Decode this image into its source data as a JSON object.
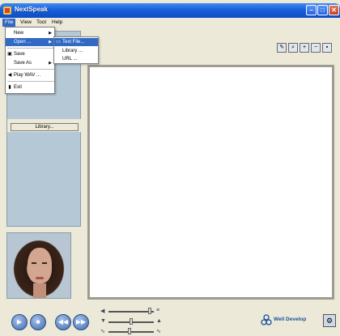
{
  "window": {
    "title": "NextSpeak"
  },
  "menubar": {
    "items": [
      "File",
      "View",
      "Tool",
      "Help"
    ]
  },
  "file_menu": {
    "items": [
      {
        "label": "New",
        "submenu": true
      },
      {
        "label": "Open ...",
        "submenu": true
      },
      {
        "label": "Save",
        "submenu": false
      },
      {
        "label": "Save As",
        "submenu": true
      },
      {
        "label": "Play WAV ...",
        "submenu": false
      },
      {
        "label": "Exit",
        "submenu": false
      }
    ]
  },
  "open_submenu": {
    "items": [
      "Text File...",
      "Library ...",
      "URL ..."
    ]
  },
  "left_panel": {
    "library_button": "Library..."
  },
  "toolbar": {
    "icons": [
      "edit-icon",
      "zoom-icon",
      "zoom-in-icon",
      "zoom-out-icon",
      "export-icon"
    ]
  },
  "controls": {
    "buttons": [
      "play-icon",
      "stop-icon",
      "rewind-icon",
      "forward-icon"
    ]
  },
  "logo": {
    "name": "Well Develop"
  },
  "colors": {
    "titlebar": "#1a5fd8",
    "panel": "#b5c8d6",
    "menu_highlight": "#316ac5"
  }
}
